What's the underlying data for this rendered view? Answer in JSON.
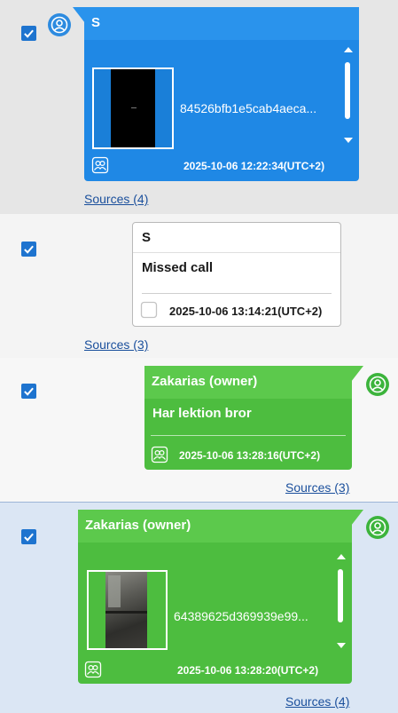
{
  "messages": [
    {
      "sender": "S",
      "filename": "84526bfb1e5cab4aeca...",
      "timestamp": "2025-10-06 12:22:34(UTC+2)",
      "sources": "Sources (4)",
      "selected": true
    },
    {
      "sender": "S",
      "body": "Missed call",
      "timestamp": "2025-10-06 13:14:21(UTC+2)",
      "sources": "Sources (3)",
      "selected": true
    },
    {
      "sender": "Zakarias (owner)",
      "body": "Har lektion bror",
      "timestamp": "2025-10-06 13:28:16(UTC+2)",
      "sources": "Sources (3)",
      "selected": true
    },
    {
      "sender": "Zakarias (owner)",
      "filename": "64389625d369939e99...",
      "timestamp": "2025-10-06 13:28:20(UTC+2)",
      "sources": "Sources (4)",
      "selected": true
    }
  ],
  "icons": {
    "checkbox": "check-icon",
    "avatar": "user-icon",
    "source": "sources-icon",
    "call": "phone-icon"
  },
  "colors": {
    "incoming_bubble": "#1f88e5",
    "outgoing_bubble": "#4dbd3f",
    "checkbox": "#1e74cf",
    "link": "#1a4f9c",
    "selected_row": "#dbe6f4"
  }
}
